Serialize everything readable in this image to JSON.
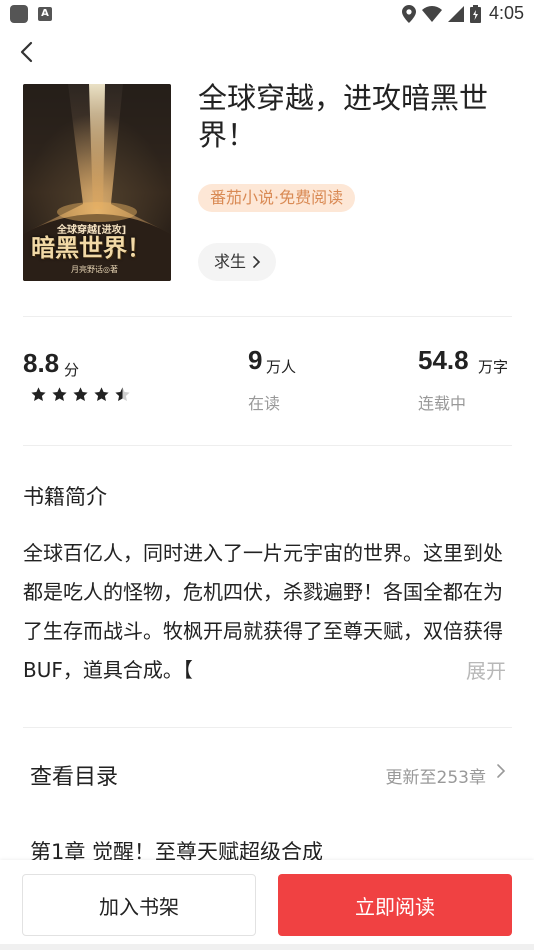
{
  "status_bar": {
    "time": "4:05"
  },
  "book": {
    "title": "全球穿越，进攻暗黑世界！",
    "tag": "番茄小说·免费阅读",
    "genre": "求生",
    "cover_text_top": "全球穿越[进攻]",
    "cover_text_main": "暗黑世界！",
    "cover_text_author": "月亮野话◎著"
  },
  "stats": {
    "rating": "8.8",
    "rating_unit": "分",
    "rating_stars": 4.5,
    "readers": "9",
    "readers_unit": "万人",
    "readers_label": "在读",
    "words": "54.8",
    "words_unit": "万字",
    "words_label": "连载中"
  },
  "synopsis": {
    "title": "书籍简介",
    "text": "全球百亿人，同时进入了一片元宇宙的世界。这里到处都是吃人的怪物，危机四伏，杀戮遍野！各国全都在为了生存而战斗。牧枫开局就获得了至尊天赋，双倍获得BUF，道具合成。【",
    "expand_label": "展开"
  },
  "catalog": {
    "title": "查看目录",
    "update": "更新至253章",
    "first_chapter": "第1章 觉醒！至尊天赋超级合成"
  },
  "actions": {
    "add_shelf": "加入书架",
    "read_now": "立即阅读"
  },
  "colors": {
    "accent": "#f04142",
    "tag_bg": "#fde7d6",
    "tag_text": "#d98a54",
    "muted": "#999999"
  }
}
